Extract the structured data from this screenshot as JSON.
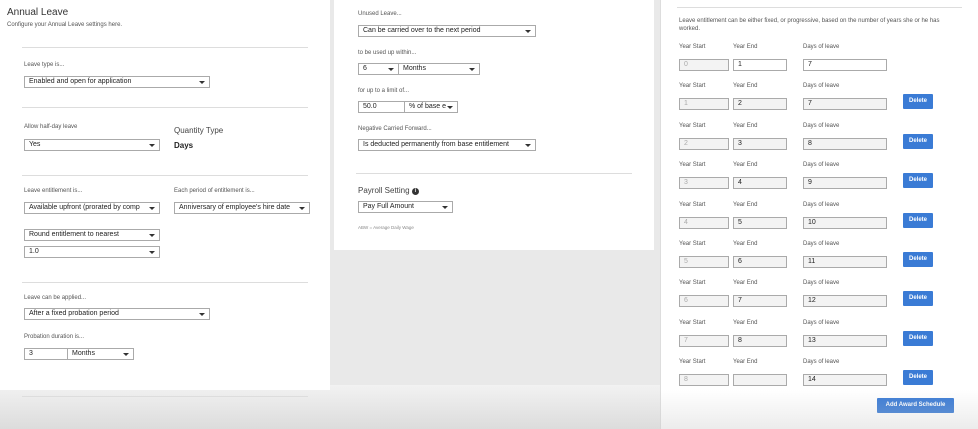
{
  "left": {
    "title": "Annual Leave",
    "subtitle": "Configure your Annual Leave settings here.",
    "leave_type_label": "Leave type is...",
    "leave_type_value": "Enabled and open for application",
    "half_day_label": "Allow half-day leave",
    "half_day_value": "Yes",
    "quantity_type_label": "Quantity Type",
    "quantity_type_value": "Days",
    "entitlement_label": "Leave entitlement is...",
    "entitlement_value": "Available upfront (prorated by comp",
    "period_label": "Each period of entitlement is...",
    "period_value": "Anniversary of employee's hire datе",
    "round_value": "Round entitlement to nearest",
    "round_amount_value": "1.0",
    "applied_label": "Leave can be applied...",
    "applied_value": "After a fixed probation period",
    "probation_label": "Probation duration is...",
    "probation_number": "3",
    "probation_unit": "Months"
  },
  "mid": {
    "unused_label": "Unused Leave...",
    "unused_value": "Can be carried over to the next period",
    "used_within_label": "to be used up within...",
    "used_within_number": "6",
    "used_within_unit": "Months",
    "limit_label": "for up to a limit of...",
    "limit_value": "50.0",
    "limit_unit": "% of base е",
    "negative_label": "Negative Carried Forward...",
    "negative_value": "Is deducted permanently from base entitlement",
    "payroll_label": "Payroll Setting",
    "payroll_value": "Pay Full Amount",
    "payroll_note": "ABW = Average Daily Wage"
  },
  "right": {
    "description": "Leave entitlement can be either fixed, or progressive, based on the number of years she or he has worked.",
    "col_year_start": "Year Start",
    "col_year_end": "Year End",
    "col_days": "Days of leave",
    "delete_label": "Delete",
    "add_label": "Add Award Schedule",
    "rows": [
      {
        "start": "0",
        "end": "1",
        "days": "7",
        "deletable": false
      },
      {
        "start": "1",
        "end": "2",
        "days": "7",
        "deletable": true
      },
      {
        "start": "2",
        "end": "3",
        "days": "8",
        "deletable": true
      },
      {
        "start": "3",
        "end": "4",
        "days": "9",
        "deletable": true
      },
      {
        "start": "4",
        "end": "5",
        "days": "10",
        "deletable": true
      },
      {
        "start": "5",
        "end": "6",
        "days": "11",
        "deletable": true
      },
      {
        "start": "6",
        "end": "7",
        "days": "12",
        "deletable": true
      },
      {
        "start": "7",
        "end": "8",
        "days": "13",
        "deletable": true
      },
      {
        "start": "8",
        "end": "",
        "days": "14",
        "deletable": true
      }
    ]
  }
}
